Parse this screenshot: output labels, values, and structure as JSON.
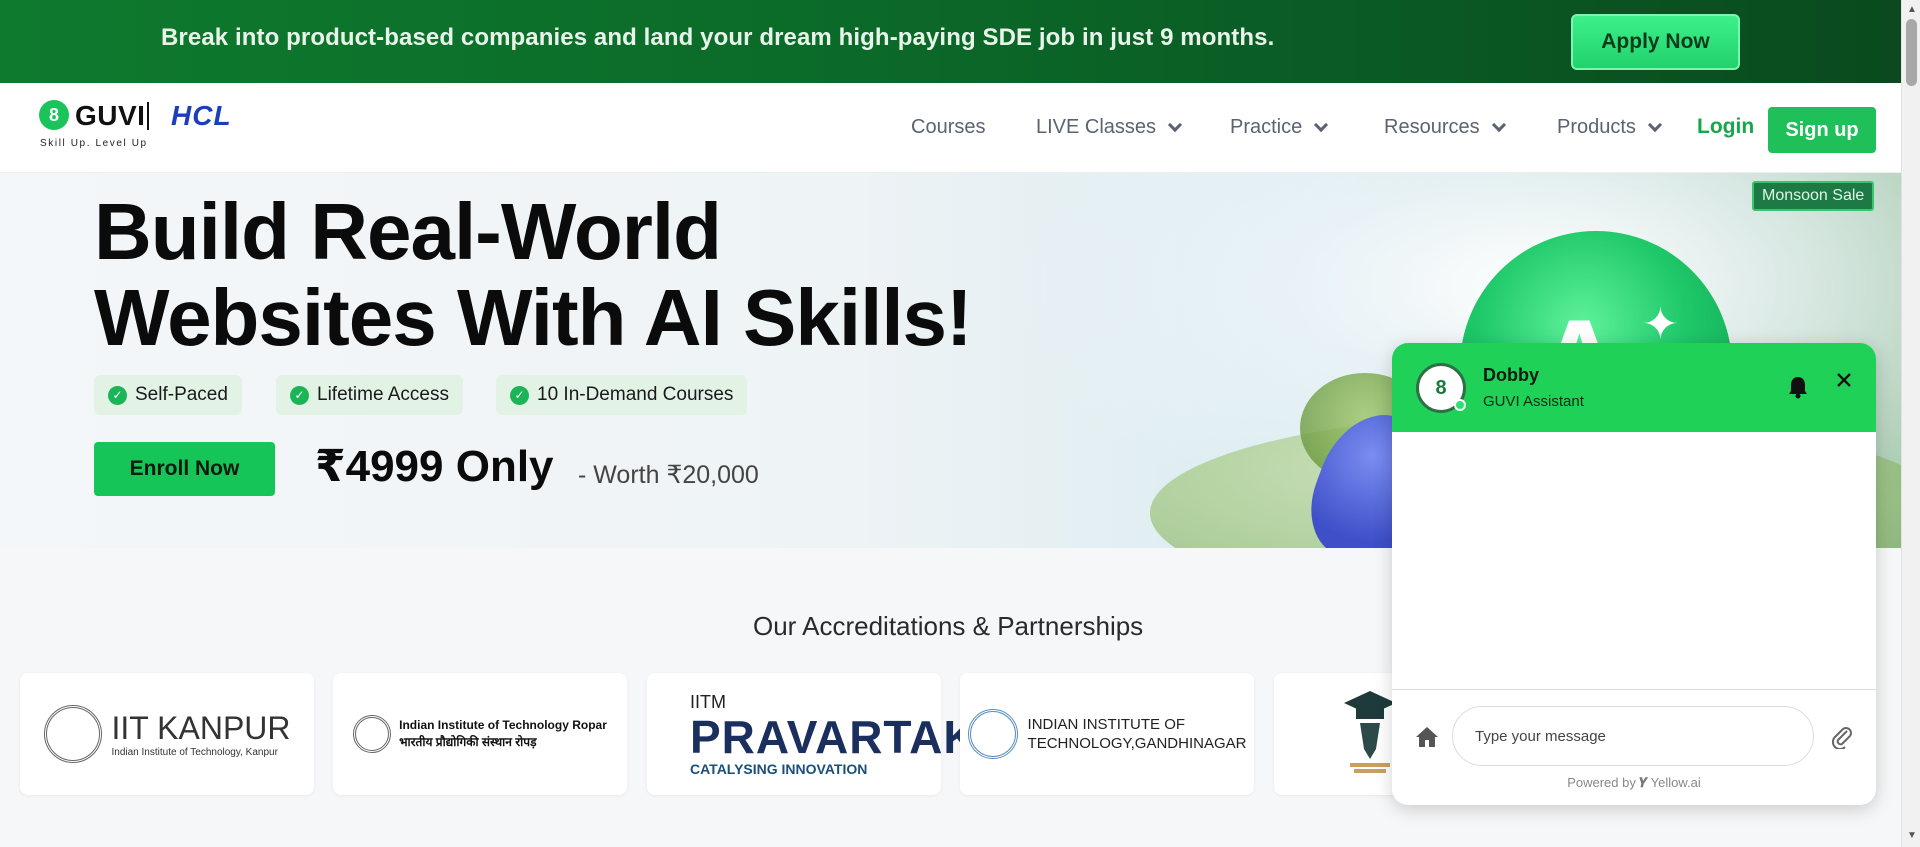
{
  "promo": {
    "text": "Break into product-based companies and land your dream high-paying SDE job in just 9 months.",
    "cta": "Apply Now"
  },
  "nav": {
    "logo_mark": "8",
    "logo_guvi": "GUVI",
    "logo_hcl": "HCL",
    "logo_tagline": "Skill Up. Level Up",
    "menu": [
      {
        "label": "Courses"
      },
      {
        "label": "LIVE Classes"
      },
      {
        "label": "Practice"
      },
      {
        "label": "Resources"
      },
      {
        "label": "Products"
      }
    ],
    "login": "Login",
    "signup": "Sign up"
  },
  "hero": {
    "title_line1": "Build Real-World",
    "title_line2": "Websites With AI Skills!",
    "features": [
      "Self-Paced",
      "Lifetime Access",
      "10 In-Demand Courses"
    ],
    "enroll": "Enroll Now",
    "price": "₹4999 Only",
    "worth": "- Worth ₹20,000",
    "sale_badge": "Monsoon Sale",
    "orb_letter": "A"
  },
  "accreditations": {
    "title": "Our Accreditations & Partnerships",
    "cards": [
      {
        "name": "IIT KANPUR",
        "sub": "Indian Institute of Technology, Kanpur"
      },
      {
        "name": "Indian Institute of Technology Ropar",
        "sub": "भारतीय प्रौद्योगिकी संस्थान रोपड़"
      },
      {
        "top": "IITM",
        "name": "PRAVARTAK",
        "sub": "CATALYSING INNOVATION"
      },
      {
        "name": "INDIAN INSTITUTE OF",
        "sub": "TECHNOLOGY,GANDHINAGAR"
      }
    ]
  },
  "chat": {
    "bot_name": "Dobby",
    "bot_subtitle": "GUVI Assistant",
    "input_placeholder": "Type your message",
    "powered_by": "Powered by",
    "powered_brand": "Yellow.ai"
  },
  "colors": {
    "brand_green": "#1fbf5a",
    "promo_green": "#0e7a2e",
    "hcl_blue": "#1b3fb8",
    "chat_header": "#1fd156"
  },
  "icons": [
    "check-icon",
    "chevron-down-icon",
    "bell-icon",
    "close-icon",
    "home-icon",
    "attachment-icon"
  ]
}
